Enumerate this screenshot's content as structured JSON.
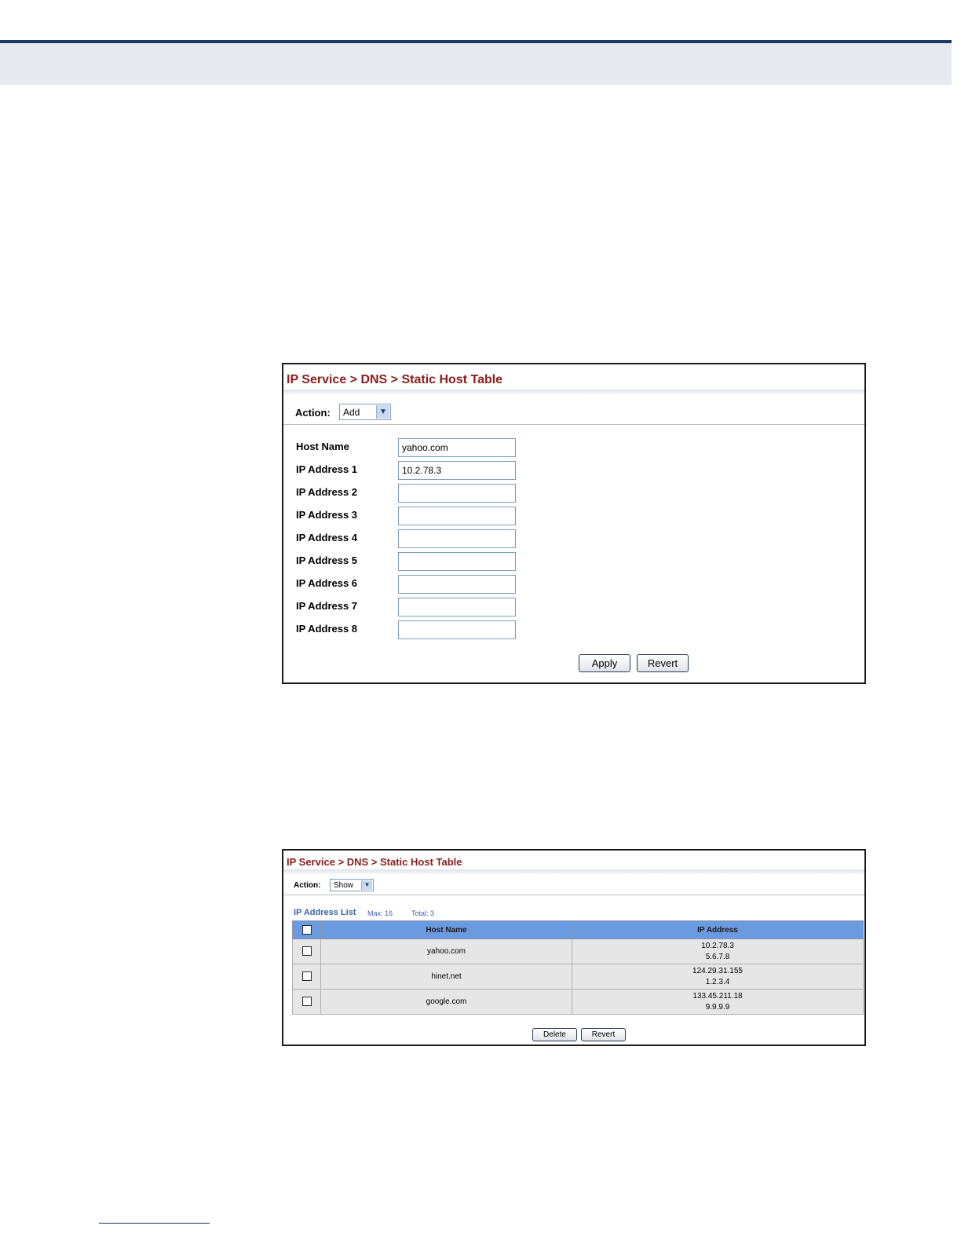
{
  "panel_add": {
    "breadcrumb": "IP Service > DNS > Static Host Table",
    "action_label": "Action:",
    "action_value": "Add",
    "fields": [
      {
        "label": "Host Name",
        "value": "yahoo.com"
      },
      {
        "label": "IP Address 1",
        "value": "10.2.78.3"
      },
      {
        "label": "IP Address 2",
        "value": ""
      },
      {
        "label": "IP Address 3",
        "value": ""
      },
      {
        "label": "IP Address 4",
        "value": ""
      },
      {
        "label": "IP Address 5",
        "value": ""
      },
      {
        "label": "IP Address 6",
        "value": ""
      },
      {
        "label": "IP Address 7",
        "value": ""
      },
      {
        "label": "IP Address 8",
        "value": ""
      }
    ],
    "apply_label": "Apply",
    "revert_label": "Revert"
  },
  "panel_show": {
    "breadcrumb": "IP Service > DNS > Static Host Table",
    "action_label": "Action:",
    "action_value": "Show",
    "list_title": "IP Address List",
    "max_text": "Max: 16",
    "total_text": "Total: 3",
    "columns": [
      "Host Name",
      "IP Address"
    ],
    "rows": [
      {
        "host": "yahoo.com",
        "ips": [
          "10.2.78.3",
          "5.6.7.8"
        ]
      },
      {
        "host": "hinet.net",
        "ips": [
          "124.29.31.155",
          "1.2.3.4"
        ]
      },
      {
        "host": "google.com",
        "ips": [
          "133.45.211.18",
          "9.9.9.9"
        ]
      }
    ],
    "delete_label": "Delete",
    "revert_label": "Revert"
  },
  "colors": {
    "breadcrumb": "#8a1c1c",
    "table_header": "#6a9ae0",
    "list_title": "#3a63a8",
    "page_rule": "#1f3864"
  }
}
